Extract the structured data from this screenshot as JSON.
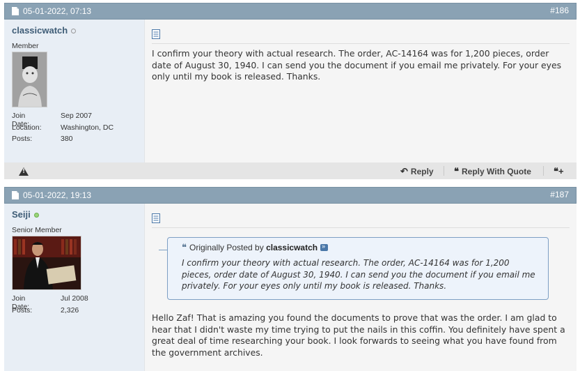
{
  "posts": [
    {
      "date": "05-01-2022, 07:13",
      "number": "#186",
      "username": "classicwatch",
      "online": false,
      "user_title": "Member",
      "info": [
        {
          "label": "Join Date:",
          "value": "Sep 2007"
        },
        {
          "label": "Location:",
          "value": "Washington, DC"
        },
        {
          "label": "Posts:",
          "value": "380"
        }
      ],
      "message": "I confirm your theory with actual research. The order, AC-14164 was for 1,200 pieces, order date of August 30, 1940. I can send you the document if you email me privately. For your eyes only until my book is released. Thanks."
    },
    {
      "date": "05-01-2022, 19:13",
      "number": "#187",
      "username": "Seiji",
      "online": true,
      "user_title": "Senior Member",
      "info": [
        {
          "label": "Join Date:",
          "value": "Jul 2008"
        },
        {
          "label": "Posts:",
          "value": "2,326"
        }
      ],
      "quote": {
        "prefix": "Originally Posted by",
        "author": "classicwatch",
        "text": "I confirm your theory with actual research. The order, AC-14164 was for 1,200 pieces, order date of August 30, 1940. I can send you the document if you email me privately. For your eyes only until my book is released. Thanks."
      },
      "message": "Hello Zaf! That is amazing you found the documents to prove that was the order. I am glad to hear that I didn't waste my time trying to put the nails in this coffin. You definitely have spent a great deal of time researching your book. I look forwards to seeing what you have found from the government archives."
    }
  ],
  "footer": {
    "reply_label": "Reply",
    "reply_quote_label": "Reply With Quote"
  },
  "colors": {
    "header": "#8aa2b4",
    "userinfo_bg": "#e8eef5",
    "username": "#3e5c76",
    "quote_border": "#7d9fc4"
  }
}
